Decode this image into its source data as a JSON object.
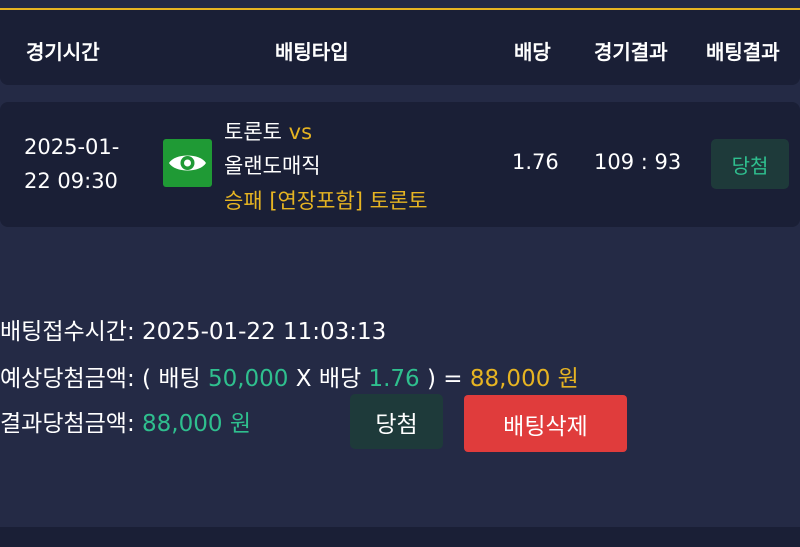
{
  "header": {
    "col_time": "경기시간",
    "col_type": "배팅타입",
    "col_odds": "배당",
    "col_game_result": "경기결과",
    "col_bet_result": "배팅결과"
  },
  "bet": {
    "time_line1": "2025-01-",
    "time_line2": "22 09:30",
    "home_team": "토론토",
    "vs": "vs",
    "away_team": "올랜도매직",
    "pick": "승패 [연장포함] 토론토",
    "odds": "1.76",
    "score": "109 : 93",
    "result": "당첨",
    "sport_icon": "eye-icon"
  },
  "summary": {
    "receipt_label": "배팅접수시간:",
    "receipt_value": "2025-01-22 11:03:13",
    "expected_label": "예상당첨금액:",
    "expected_open": "( 배팅",
    "bet_amount": "50,000",
    "times": "X 배당",
    "expected_odds": "1.76",
    "expected_close": ") =",
    "expected_total": "88,000 원",
    "result_label": "결과당첨금액:",
    "result_amount": "88,000 원",
    "win_button": "당첨",
    "delete_button": "배팅삭제"
  },
  "colors": {
    "accent_gold": "#e6b422",
    "win_green": "#2fbf8e",
    "delete_red": "#e03c3c",
    "panel": "#1a1f36",
    "background": "#242a45"
  }
}
